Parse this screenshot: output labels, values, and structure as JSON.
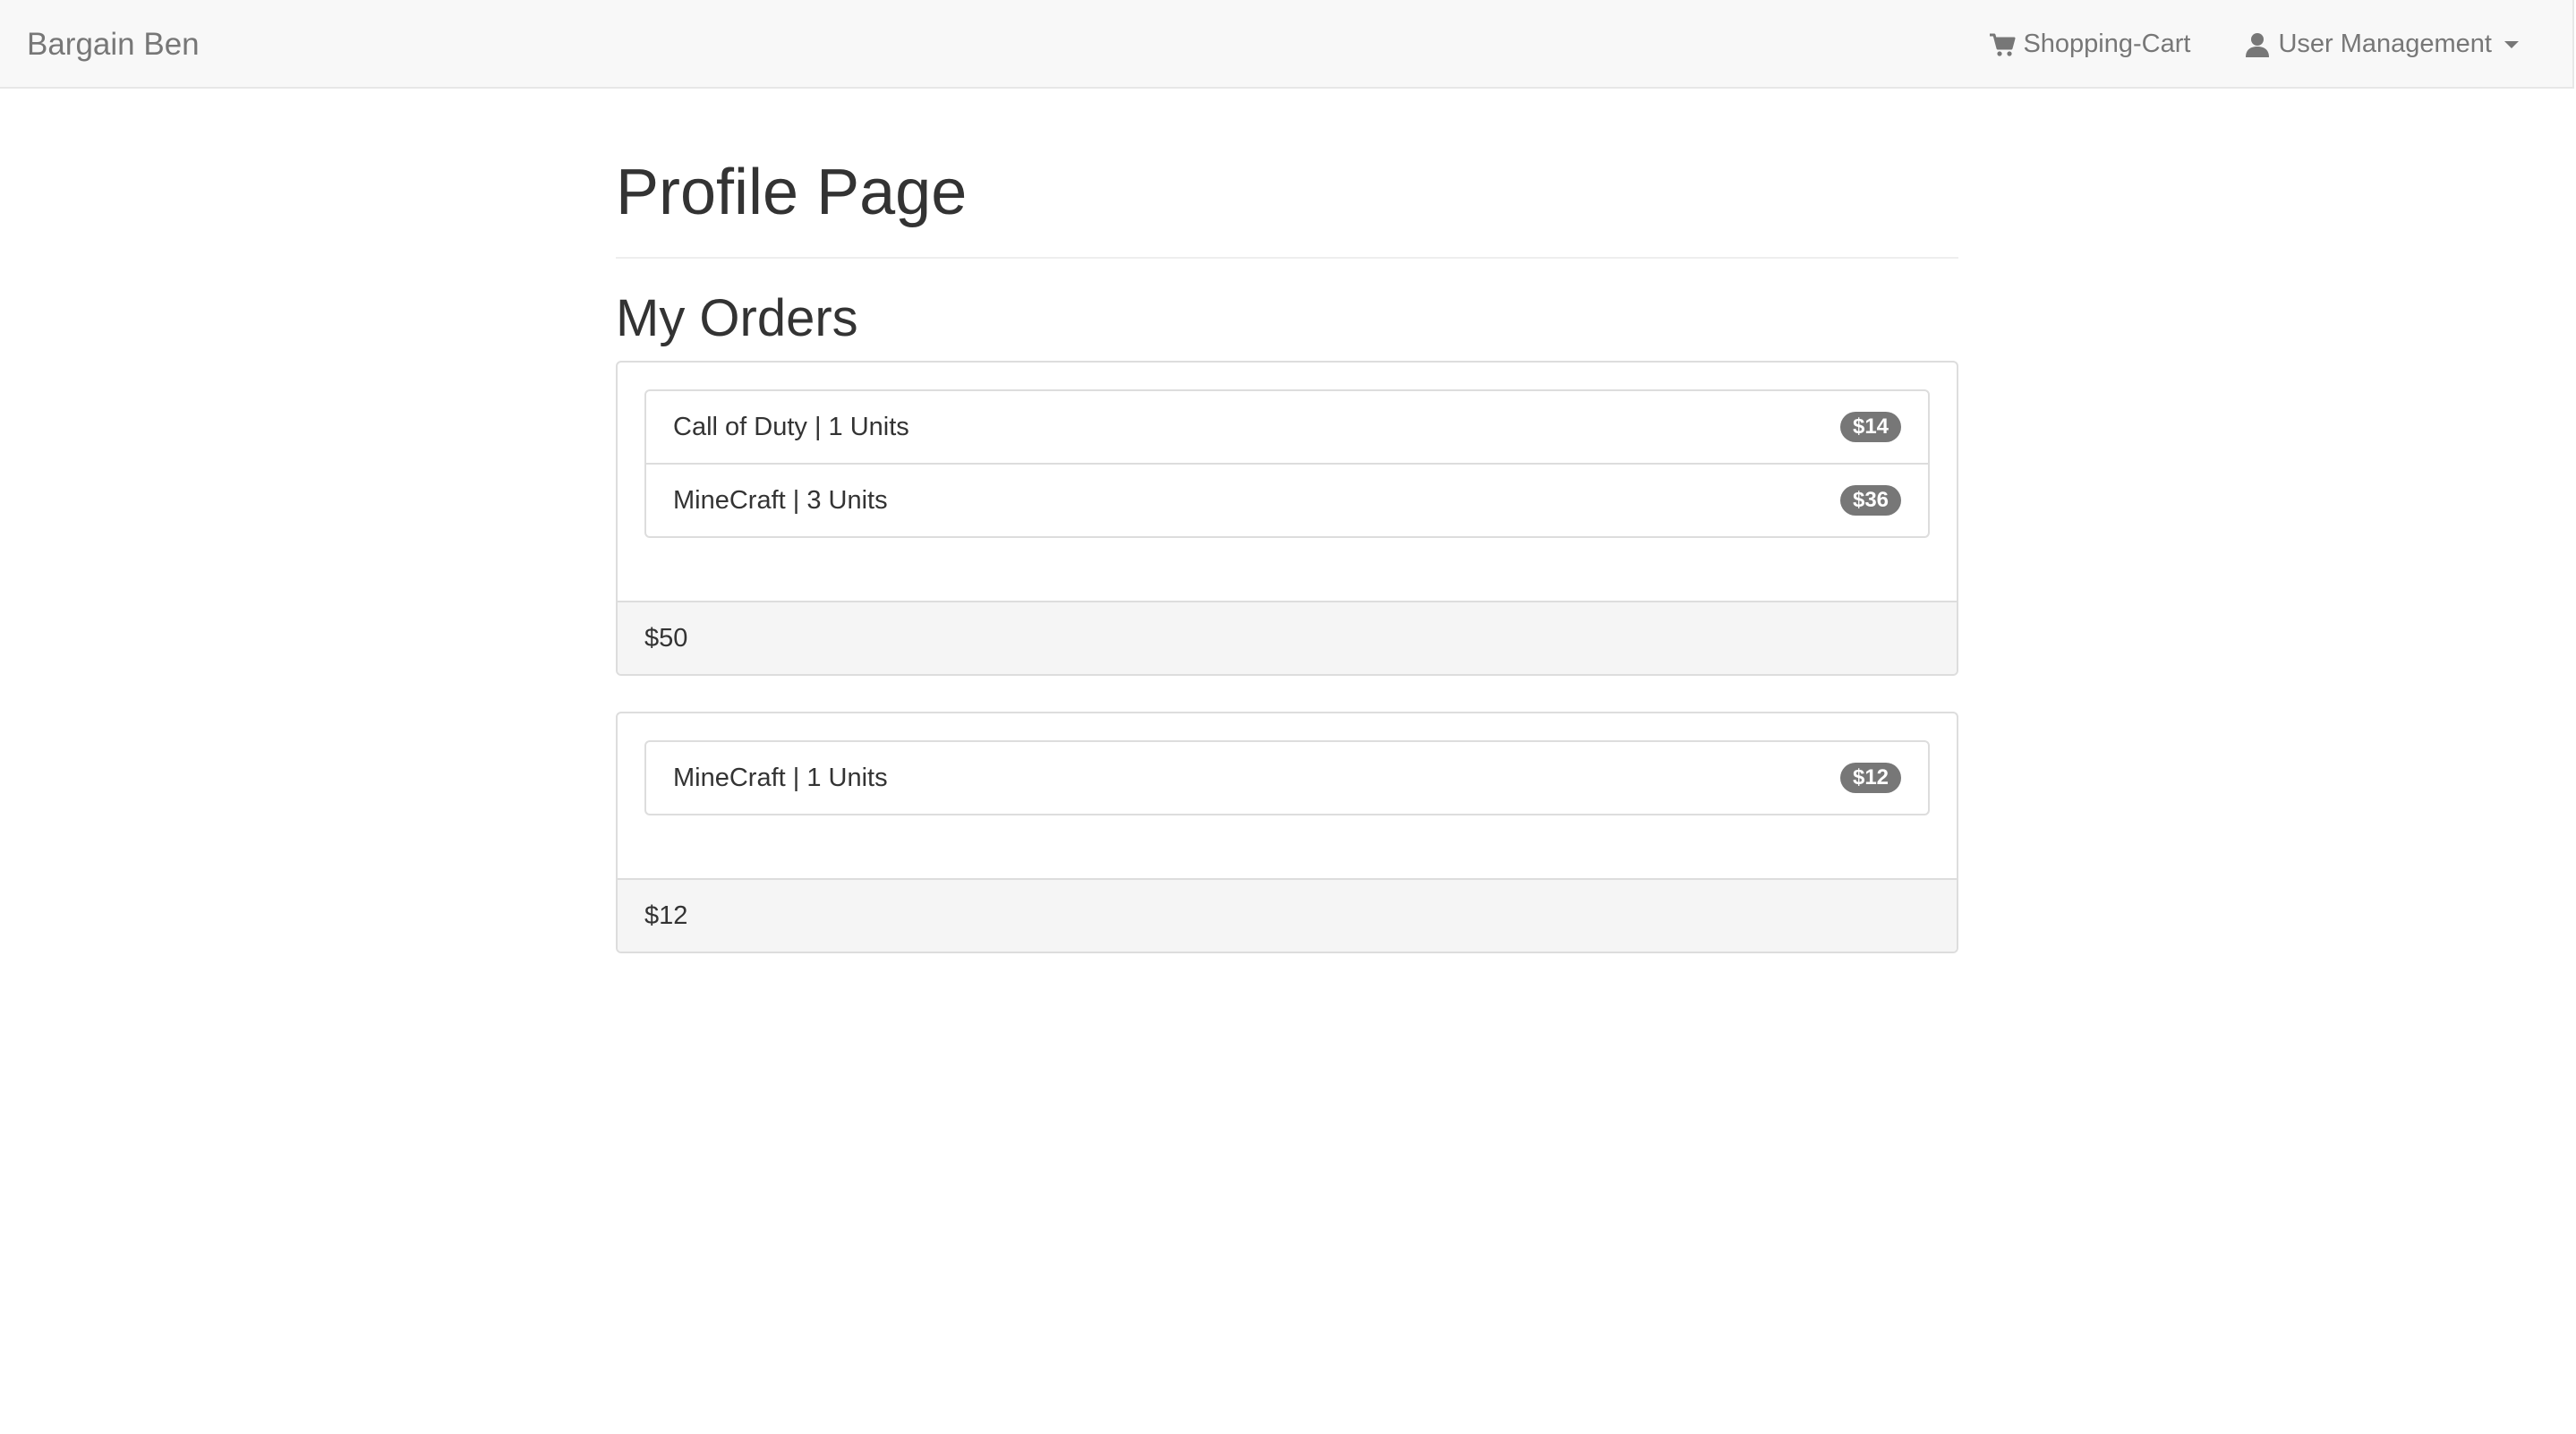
{
  "navbar": {
    "brand": "Bargain Ben",
    "cart_label": "Shopping-Cart",
    "cart_icon": "shopping-cart-icon",
    "user_label": "User Management",
    "user_icon": "user-icon"
  },
  "page": {
    "title": "Profile Page",
    "section_title": "My Orders"
  },
  "orders": [
    {
      "items": [
        {
          "label": "Call of Duty | 1 Units",
          "price": "$14"
        },
        {
          "label": "MineCraft | 3 Units",
          "price": "$36"
        }
      ],
      "total": "$50"
    },
    {
      "items": [
        {
          "label": "MineCraft | 1 Units",
          "price": "$12"
        }
      ],
      "total": "$12"
    }
  ],
  "colors": {
    "navbar_bg": "#f8f8f8",
    "nav_text": "#777777",
    "badge_bg": "#777777",
    "footer_bg": "#f5f5f5"
  }
}
